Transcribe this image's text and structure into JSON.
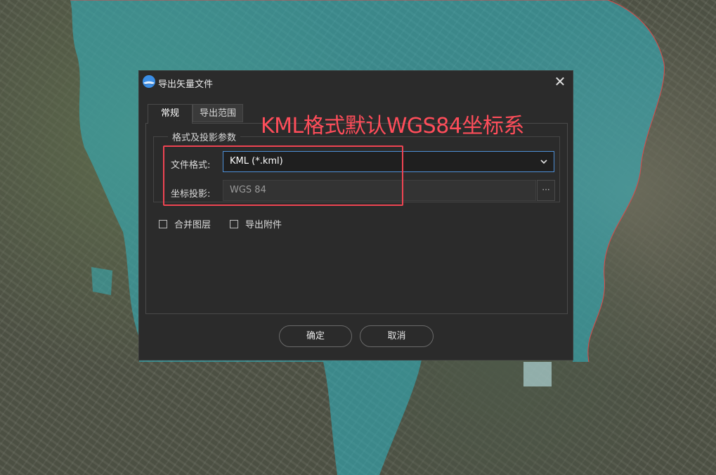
{
  "dialog": {
    "title": "导出矢量文件",
    "close_glyph": "✕",
    "tabs": [
      {
        "label": "常规",
        "active": true
      },
      {
        "label": "导出范围",
        "active": false
      }
    ],
    "group_title": "格式及投影参数",
    "format": {
      "label": "文件格式:",
      "value": "KML (*.kml)",
      "icon": "chevron-down-icon"
    },
    "projection": {
      "label": "坐标投影:",
      "value": "WGS 84",
      "browse_glyph": "···"
    },
    "checkboxes": [
      {
        "label": "合并图层",
        "checked": false
      },
      {
        "label": "导出附件",
        "checked": false
      }
    ],
    "buttons": {
      "ok": "确定",
      "cancel": "取消"
    }
  },
  "annotation": {
    "text": "KML格式默认WGS84坐标系",
    "color": "#ff4d5a"
  },
  "colors": {
    "accent": "#4e8fd6",
    "water_overlay": "#2fb7c4"
  }
}
